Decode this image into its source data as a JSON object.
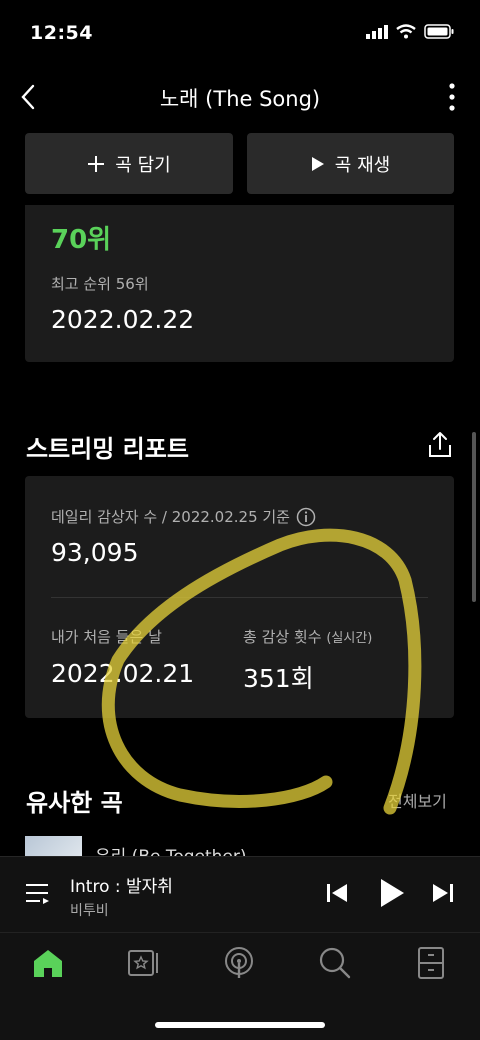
{
  "status": {
    "time": "12:54"
  },
  "header": {
    "title": "노래 (The Song)"
  },
  "actions": {
    "add_label": "곡 담기",
    "play_label": "곡 재생"
  },
  "chart": {
    "rank": "70위",
    "peak_label": "최고 순위 56위",
    "peak_date": "2022.02.22"
  },
  "streaming": {
    "title": "스트리밍 리포트",
    "daily_label": "데일리 감상자 수 / 2022.02.25 기준",
    "daily_value": "93,095",
    "first_listen_label": "내가 처음 들은 날",
    "first_listen_value": "2022.02.21",
    "total_label": "총 감상 횟수",
    "total_label_sub": "(실시간)",
    "total_value": "351회"
  },
  "similar": {
    "title": "유사한 곡",
    "see_all": "전체보기",
    "first_song": "우리 (Be Together)"
  },
  "now_playing": {
    "title": "Intro : 발자취",
    "artist": "비투비"
  },
  "colors": {
    "accent": "#5ad25a",
    "annotation": "#e6d23a",
    "card": "#1c1c1c",
    "button": "#2a2a2a"
  },
  "tabs": [
    "home-icon",
    "library-icon",
    "podcast-icon",
    "search-icon",
    "storage-icon"
  ]
}
